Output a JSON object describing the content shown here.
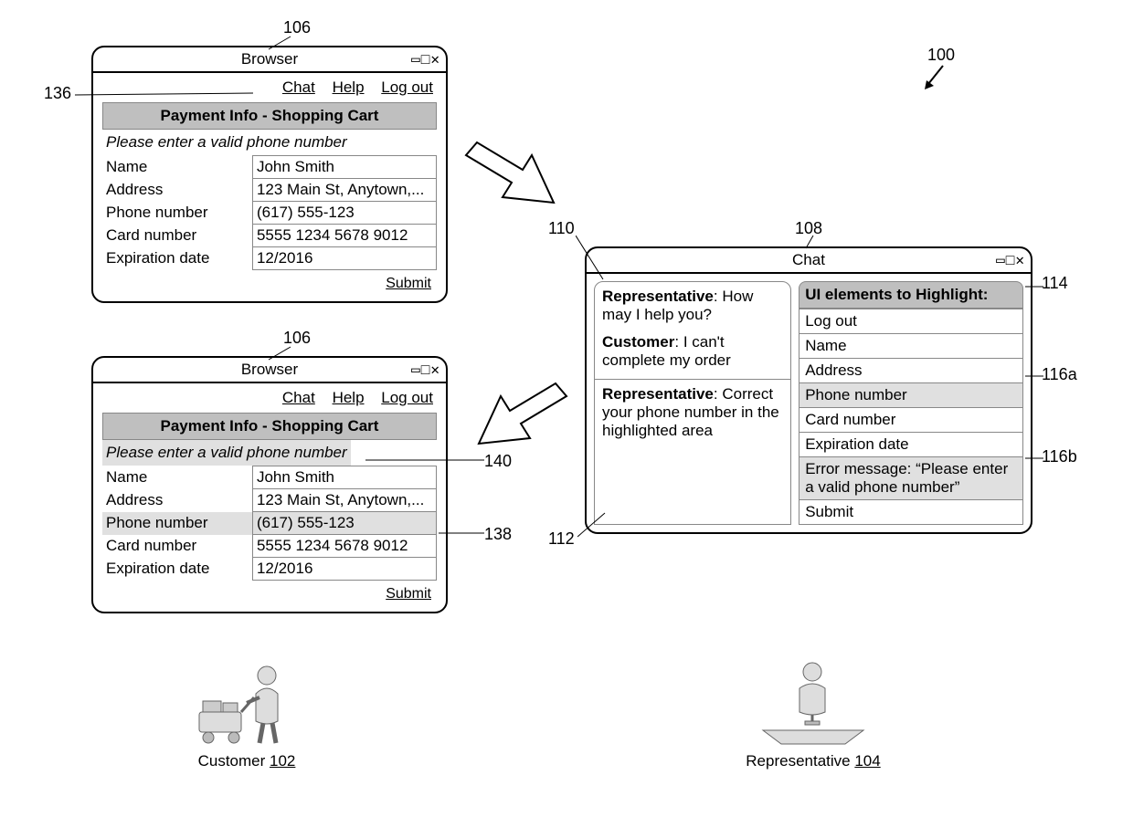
{
  "refs": {
    "system": "100",
    "customer": "102",
    "representative": "104",
    "browser_window": "106",
    "chat_window": "108",
    "chat_transcript": "110",
    "chat_message_ref": "112",
    "ui_highlight_panel": "114",
    "highlight_item_phone": "116a",
    "highlight_item_error": "116b",
    "nav_bar_ref": "136",
    "highlighted_phone_row": "138",
    "highlighted_error_msg": "140"
  },
  "browser": {
    "title": "Browser",
    "nav": {
      "chat": "Chat",
      "help": "Help",
      "logout": "Log out"
    },
    "section_title": "Payment Info - Shopping Cart",
    "error": "Please enter a valid phone number",
    "fields": [
      {
        "label": "Name",
        "value": "John Smith"
      },
      {
        "label": "Address",
        "value": "123 Main St, Anytown,..."
      },
      {
        "label": "Phone number",
        "value": "(617) 555-123"
      },
      {
        "label": "Card number",
        "value": "5555 1234 5678 9012"
      },
      {
        "label": "Expiration date",
        "value": "12/2016"
      }
    ],
    "submit": "Submit"
  },
  "chat": {
    "title": "Chat",
    "messages": [
      {
        "speaker": "Representative",
        "text": "How may I help you?"
      },
      {
        "speaker": "Customer",
        "text": "I can't complete my order"
      },
      {
        "speaker": "Representative",
        "text": "Correct your phone number in the highlighted area"
      }
    ],
    "highlight_title": "UI elements to Highlight:",
    "highlight_items": [
      {
        "label": "Log out",
        "selected": false
      },
      {
        "label": "Name",
        "selected": false
      },
      {
        "label": "Address",
        "selected": false
      },
      {
        "label": "Phone number",
        "selected": true
      },
      {
        "label": "Card number",
        "selected": false
      },
      {
        "label": "Expiration date",
        "selected": false
      },
      {
        "label": "Error message: “Please enter a valid phone number”",
        "selected": true
      },
      {
        "label": "Submit",
        "selected": false
      }
    ]
  },
  "actors": {
    "customer": "Customer",
    "representative": "Representative"
  },
  "win_controls": {
    "min": "−",
    "max": "□",
    "close": "✕"
  }
}
